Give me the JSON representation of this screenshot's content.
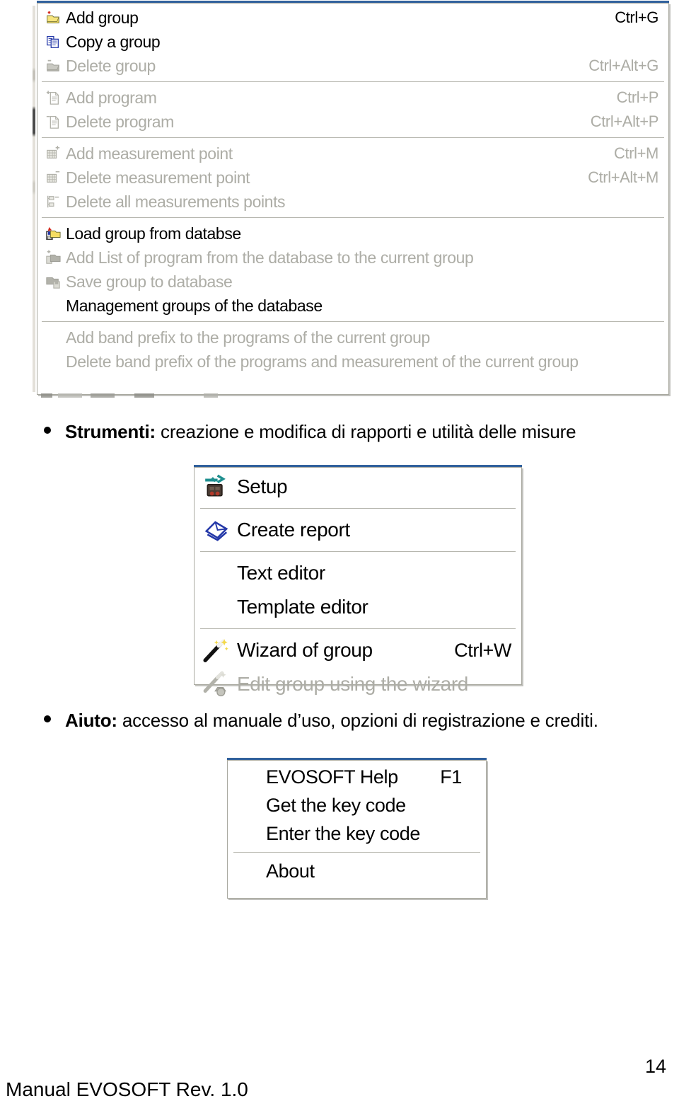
{
  "document": {
    "page_number": "14",
    "footer": "Manual EVOSOFT Rev. 1.0"
  },
  "paragraphs": {
    "strumenti": {
      "label": "Strumenti:",
      "text": " creazione e modifica di rapporti e utilità delle misure"
    },
    "aiuto": {
      "label": "Aiuto:",
      "text": " accesso al manuale d’uso, opzioni di registrazione e crediti."
    }
  },
  "menus": {
    "group_menu": {
      "name": "group-menu",
      "items": [
        {
          "icon": "add-folder-icon",
          "label": "Add group",
          "accel": "Ctrl+G",
          "enabled": true,
          "sep_after": false
        },
        {
          "icon": "copy-icon",
          "label": "Copy a group",
          "accel": "",
          "enabled": true,
          "sep_after": false
        },
        {
          "icon": "delete-folder-icon",
          "label": "Delete group",
          "accel": "Ctrl+Alt+G",
          "enabled": false,
          "sep_after": true
        },
        {
          "icon": "add-document-icon",
          "label": "Add program",
          "accel": "Ctrl+P",
          "enabled": false,
          "sep_after": false
        },
        {
          "icon": "delete-document-icon",
          "label": "Delete program",
          "accel": "Ctrl+Alt+P",
          "enabled": false,
          "sep_after": true
        },
        {
          "icon": "add-grid-icon",
          "label": "Add measurement point",
          "accel": "Ctrl+M",
          "enabled": false,
          "sep_after": false
        },
        {
          "icon": "delete-grid-icon",
          "label": "Delete measurement point",
          "accel": "Ctrl+Alt+M",
          "enabled": false,
          "sep_after": false
        },
        {
          "icon": "delete-all-points-icon",
          "label": "Delete all measurements points",
          "accel": "",
          "enabled": false,
          "sep_after": true
        },
        {
          "icon": "load-database-icon",
          "label": "Load group from databse",
          "accel": "",
          "enabled": true,
          "sep_after": false
        },
        {
          "icon": "add-list-database-icon",
          "label": "Add List of program from the database to the current group",
          "accel": "",
          "enabled": false,
          "sep_after": false
        },
        {
          "icon": "save-database-icon",
          "label": "Save group to database",
          "accel": "",
          "enabled": false,
          "sep_after": false
        },
        {
          "icon": "none",
          "label": "Management groups of the database",
          "accel": "",
          "enabled": true,
          "sep_after": true
        },
        {
          "icon": "none",
          "label": "Add band prefix to the programs of the current group",
          "accel": "",
          "enabled": false,
          "sep_after": false
        },
        {
          "icon": "none",
          "label": "Delete band prefix of the programs and measurement of the current group",
          "accel": "",
          "enabled": false,
          "sep_after": false
        }
      ]
    },
    "tools_menu": {
      "name": "tools-menu",
      "items": [
        {
          "icon": "setup-icon",
          "label": "Setup",
          "accel": "",
          "enabled": true,
          "sep_after": true
        },
        {
          "icon": "report-icon",
          "label": "Create report",
          "accel": "",
          "enabled": true,
          "sep_after": true
        },
        {
          "icon": "none",
          "label": "Text editor",
          "accel": "",
          "enabled": true,
          "sep_after": false
        },
        {
          "icon": "none",
          "label": "Template editor",
          "accel": "",
          "enabled": true,
          "sep_after": true
        },
        {
          "icon": "wand-icon",
          "label": "Wizard of group",
          "accel": "Ctrl+W",
          "enabled": true,
          "sep_after": false
        },
        {
          "icon": "wand-edit-icon",
          "label": "Edit group using the wizard",
          "accel": "",
          "enabled": false,
          "sep_after": false
        }
      ]
    },
    "help_menu": {
      "name": "help-menu",
      "items": [
        {
          "icon": "none",
          "label": "EVOSOFT Help",
          "accel": "F1",
          "enabled": true,
          "sep_after": false
        },
        {
          "icon": "none",
          "label": "Get the key code",
          "accel": "",
          "enabled": true,
          "sep_after": false
        },
        {
          "icon": "none",
          "label": "Enter the key code",
          "accel": "",
          "enabled": true,
          "sep_after": true
        },
        {
          "icon": "none",
          "label": "About",
          "accel": "",
          "enabled": true,
          "sep_after": false
        }
      ]
    }
  },
  "colors": {
    "menu_background": "#ffffff",
    "menu_border": "#a9a9a0",
    "menu_accent_top": "#31619c",
    "disabled_text": "#adada6",
    "enabled_text": "#000000",
    "separator": "#b6b6ae",
    "folder_yellow": "#f5dd62",
    "accent_red": "#d42b1f",
    "copy_blue": "#2438a8",
    "disabled_icon_gray": "#b2b2aa",
    "setup_teal": "#1f8f8f"
  }
}
